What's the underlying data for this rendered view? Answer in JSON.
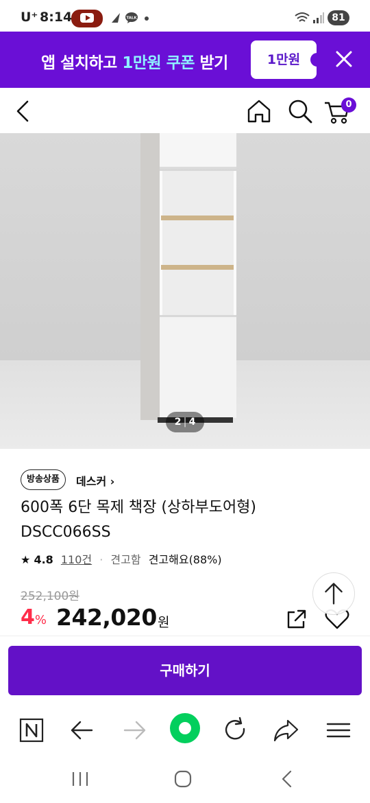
{
  "status_bar": {
    "carrier": "U⁺",
    "time": "8:14",
    "battery": "81",
    "talk_icon_text": "TALK"
  },
  "promo": {
    "text_pre": "앱 설치하고 ",
    "text_highlight": "1만원 쿠폰",
    "text_post": " 받기",
    "coupon_label": "1만원"
  },
  "header": {
    "cart_count": "0"
  },
  "gallery": {
    "current": "2",
    "separator": "|",
    "total": "4"
  },
  "product": {
    "badge": "방송상품",
    "brand": "데스커 ›",
    "title": "600폭 6단 목제 책장 (상하부도어형) DSCC066SS",
    "rating_star": "★",
    "rating_score": "4.8",
    "review_count": "110건",
    "rating_dot": "·",
    "durability_label": "견고함",
    "durability_value": "견고해요(88%)",
    "original_price": "252,100원",
    "discount_rate": "4",
    "discount_unit": "%",
    "sale_price": "242,020",
    "currency": "원"
  },
  "buy": {
    "label": "구매하기"
  },
  "colors": {
    "brand_purple": "#6311c7",
    "promo_purple": "#6a0fd6",
    "discount_red": "#ff2d4a",
    "naver_green": "#03cf5d"
  },
  "icons": {
    "promo_close": "close-icon",
    "back": "chevron-left-icon",
    "home": "home-icon",
    "search": "search-icon",
    "cart": "cart-icon",
    "share": "share-icon",
    "wishlist": "heart-icon",
    "scroll_top": "arrow-up-icon"
  }
}
